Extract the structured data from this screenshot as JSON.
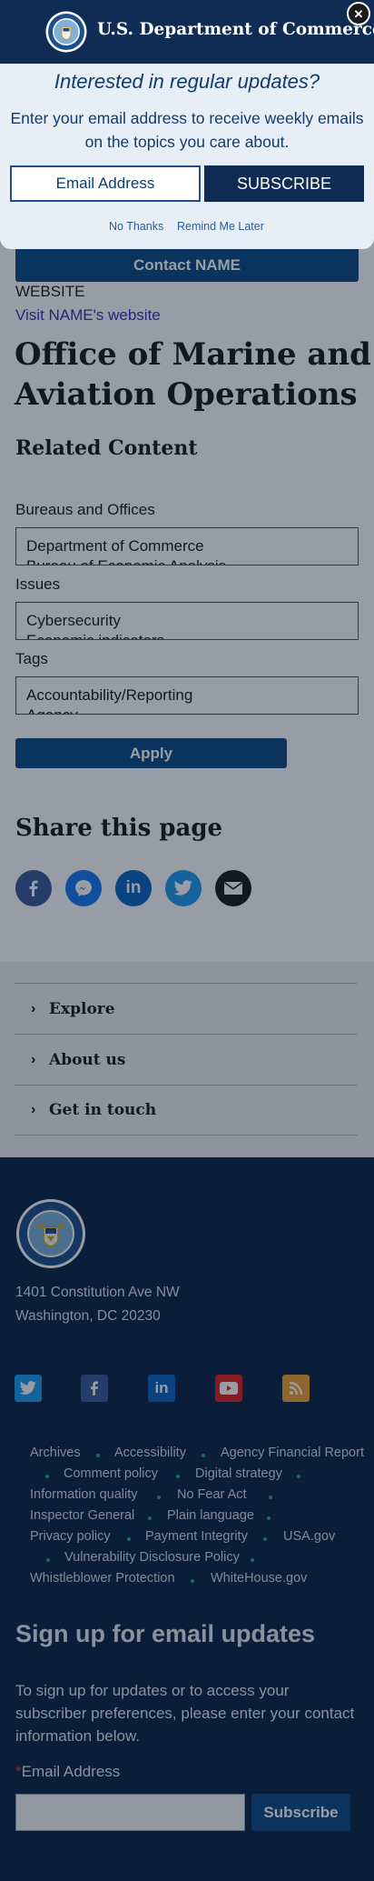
{
  "contact": {
    "button_label": "Contact NAME",
    "website_heading": "WEBSITE",
    "website_link": "Visit NAME's website"
  },
  "page": {
    "title_line1": "Office of Marine and",
    "title_line2": "Aviation Operations",
    "related_heading": "Related Content"
  },
  "filters": {
    "bureaus_label": "Bureaus and Offices",
    "bureaus_options": [
      "Department of Commerce",
      "Bureau of Economic Analysis"
    ],
    "issues_label": "Issues",
    "issues_options": [
      "Cybersecurity",
      "Economic indicators"
    ],
    "tags_label": "Tags",
    "tags_options": [
      "Accountability/Reporting",
      "Agency"
    ],
    "apply_label": "Apply"
  },
  "share": {
    "heading": "Share this page",
    "icons": [
      "facebook-icon",
      "messenger-icon",
      "linkedin-icon",
      "twitter-icon",
      "email-icon"
    ]
  },
  "accordion": {
    "items": [
      "Explore",
      "About us",
      "Get in touch"
    ]
  },
  "footer": {
    "address_line1": "1401 Constitution Ave NW",
    "address_line2": "Washington, DC 20230",
    "social": [
      "twitter-icon",
      "facebook-icon",
      "linkedin-icon",
      "youtube-icon",
      "rss-icon"
    ],
    "links": [
      "Archives",
      "Accessibility",
      "Agency Financial Report",
      "Comment policy",
      "Digital strategy",
      "Information quality",
      "No Fear Act",
      "Inspector General",
      "Plain language",
      "Privacy policy",
      "Payment Integrity",
      "USA.gov",
      "Vulnerability Disclosure Policy",
      "Whistleblower Protection",
      "WhiteHouse.gov"
    ],
    "signup_heading": "Sign up for email updates",
    "signup_text_line1": "To sign up for updates or to access your",
    "signup_text_line2": "subscriber preferences, please enter your contact",
    "signup_text_line3": "information below.",
    "required_mark": "*",
    "email_label": "Email Address",
    "subscribe_label": "Subscribe"
  },
  "modal": {
    "brand": "U.S. Department of Commerce",
    "close_glyph": "✕",
    "heading": "Interested in regular updates?",
    "text_line1": "Enter your email address to receive weekly emails",
    "text_line2": "on the topics you care about.",
    "email_placeholder": "Email Address",
    "subscribe_label": "SUBSCRIBE",
    "no_thanks": "No Thanks",
    "remind_later": "Remind Me Later"
  },
  "colors": {
    "navy": "#0f2c55",
    "primary_button": "#0b4a86",
    "footer_bg": "#0b2346",
    "accent_teal": "#2aa8a0"
  }
}
